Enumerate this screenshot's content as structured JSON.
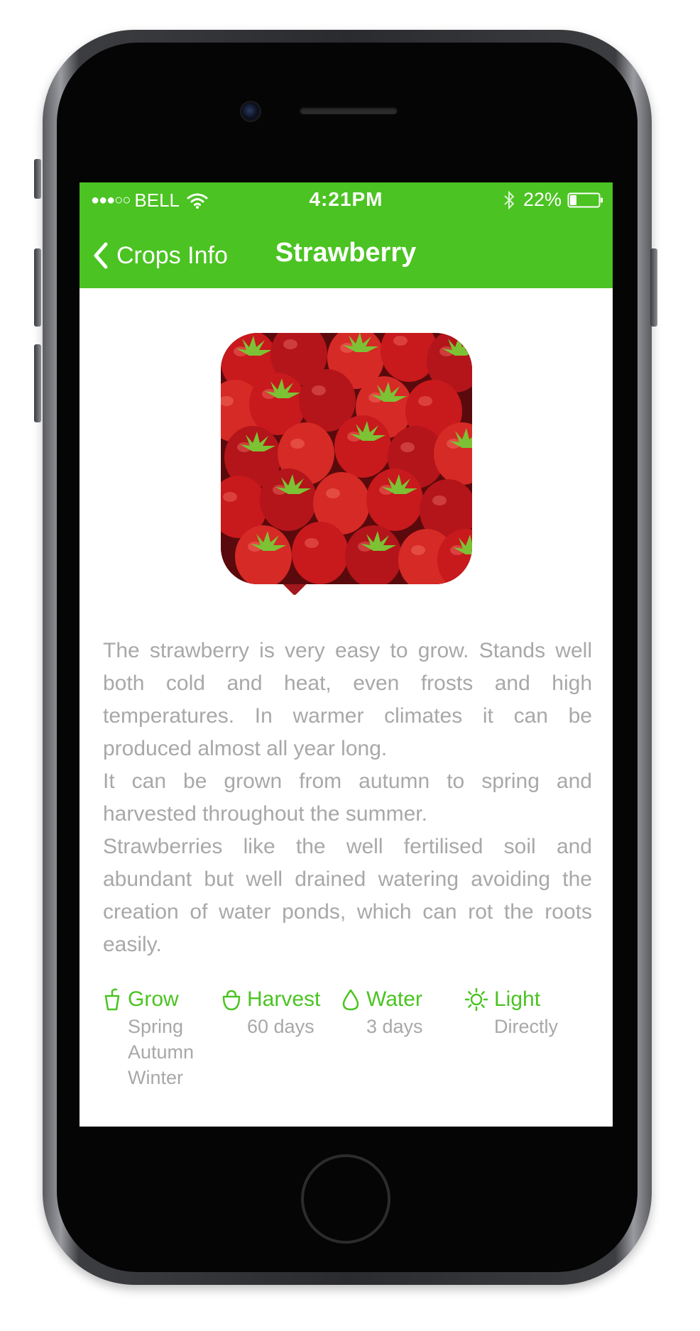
{
  "status_bar": {
    "signal": "●●●○○",
    "carrier": "BELL",
    "time": "4:21PM",
    "battery_percent": "22%",
    "battery_level": 0.22
  },
  "nav": {
    "back_label": "Crops Info",
    "title": "Strawberry"
  },
  "description": [
    "The strawberry is very easy to grow. Stands well both cold and heat, even frosts and high temperatures. In warmer climates it can be produced almost all year long.",
    "It can be grown from autumn to spring and harvested throughout the summer.",
    "Strawberries like the well fertilised soil and abundant but well drained watering avoiding the creation of water ponds, which can rot the roots easily."
  ],
  "facts": [
    {
      "icon": "pot-icon",
      "label": "Grow",
      "values": [
        "Spring",
        "Autumn",
        "Winter"
      ]
    },
    {
      "icon": "basket-icon",
      "label": "Harvest",
      "values": [
        "60 days"
      ]
    },
    {
      "icon": "water-drop-icon",
      "label": "Water",
      "values": [
        "3 days"
      ]
    },
    {
      "icon": "sun-icon",
      "label": "Light",
      "values": [
        "Directly"
      ]
    }
  ],
  "colors": {
    "accent": "#4bc322",
    "body_text": "#a8a8a8",
    "phone_body": "#2a2b2e"
  }
}
